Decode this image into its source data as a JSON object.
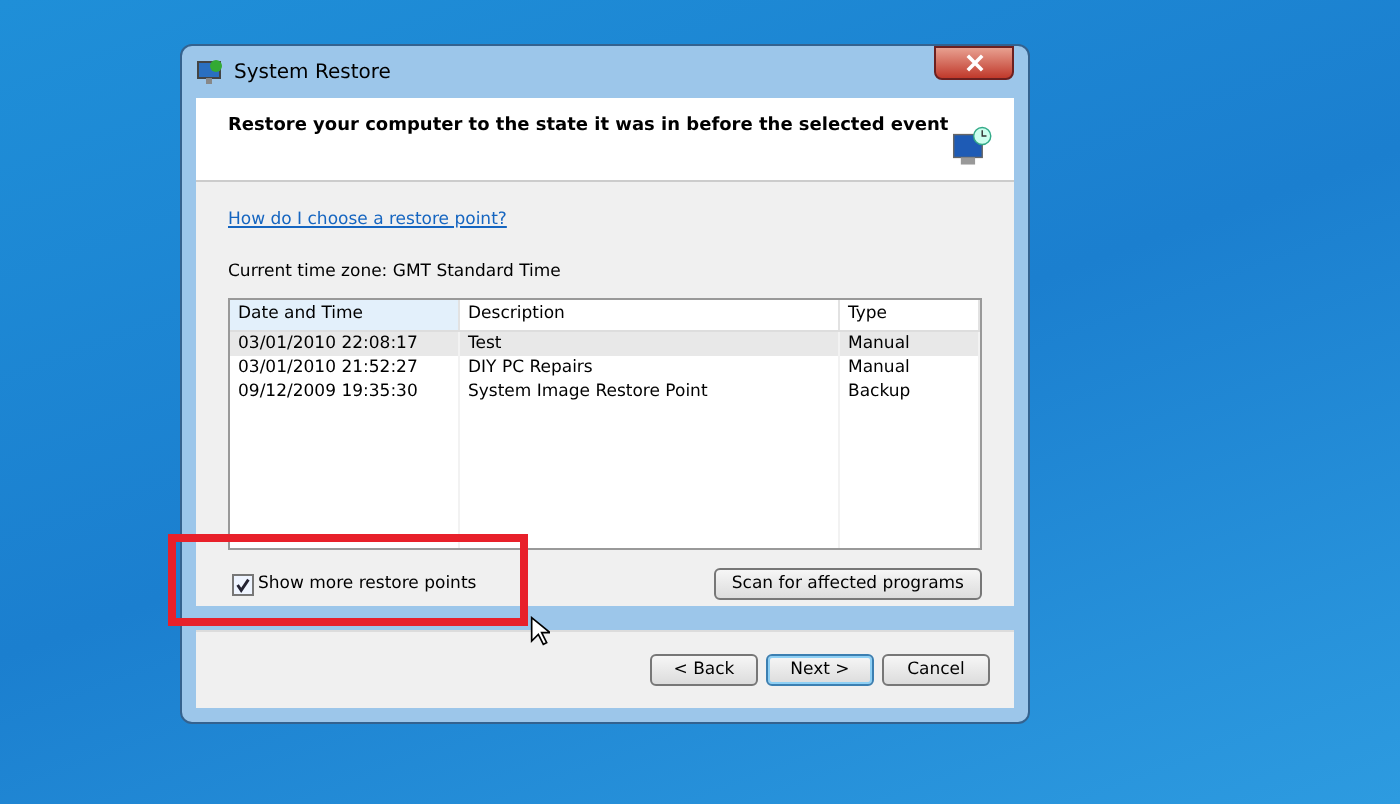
{
  "window": {
    "title": "System Restore"
  },
  "header": {
    "heading": "Restore your computer to the state it was in before the selected event"
  },
  "help_link": "How do I choose a restore point?",
  "time_zone": "Current time zone: GMT Standard Time",
  "table": {
    "columns": [
      "Date and Time",
      "Description",
      "Type"
    ],
    "rows": [
      {
        "cells": [
          "03/01/2010 22:08:17",
          "Test",
          "Manual"
        ],
        "selected": true
      },
      {
        "cells": [
          "03/01/2010 21:52:27",
          "DIY PC Repairs",
          "Manual"
        ],
        "selected": false
      },
      {
        "cells": [
          "09/12/2009 19:35:30",
          "System Image Restore Point",
          "Backup"
        ],
        "selected": false
      }
    ]
  },
  "show_more": {
    "label": "Show more restore points",
    "checked": true
  },
  "scan_button": "Scan for affected programs",
  "buttons": [
    {
      "label": "< Back",
      "default": false
    },
    {
      "label": "Next >",
      "default": true
    },
    {
      "label": "Cancel",
      "default": false
    }
  ]
}
